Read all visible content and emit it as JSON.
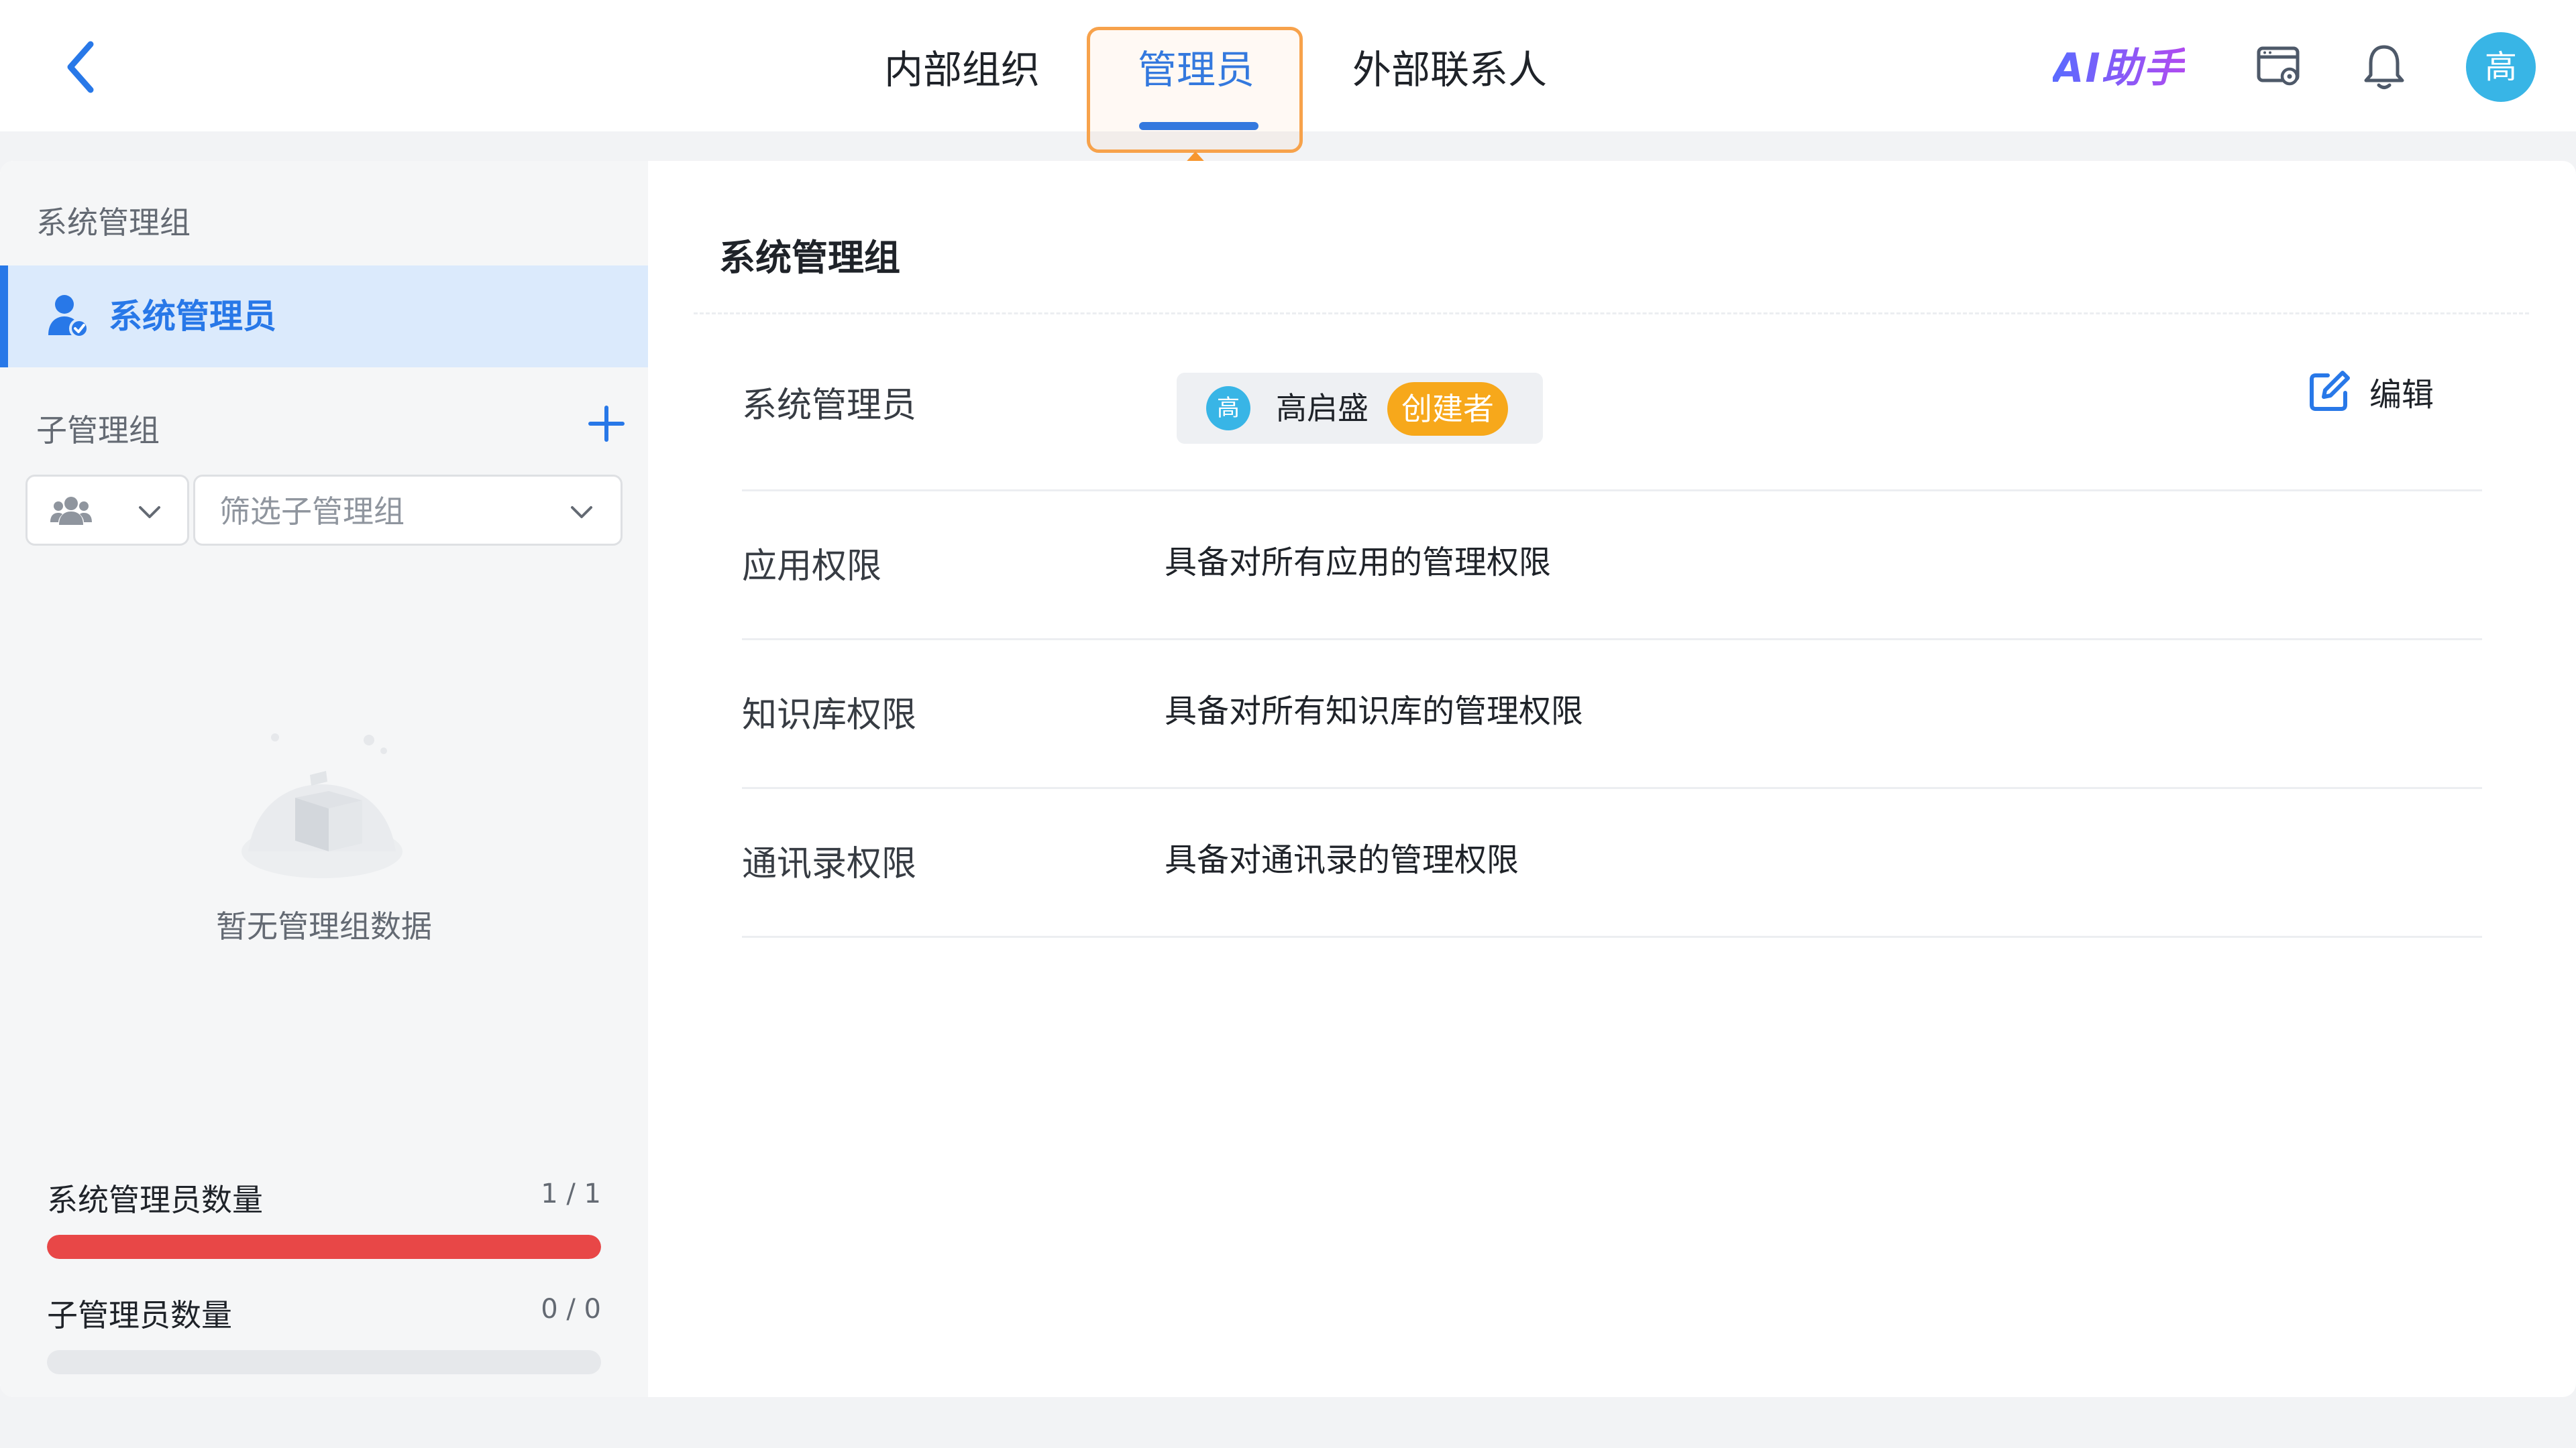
{
  "header": {
    "tabs": [
      {
        "label": "内部组织"
      },
      {
        "label": "管理员"
      },
      {
        "label": "外部联系人"
      }
    ],
    "active_tab": "管理员",
    "ai_label": "AI助手",
    "user_avatar": "高",
    "accent": "#2878e8",
    "highlight_color": "#f7a24b"
  },
  "sidebar": {
    "system_group_title": "系统管理组",
    "selected_item": "系统管理员",
    "sub_group_title": "子管理组",
    "filter_placeholder": "筛选子管理组",
    "empty_text": "暂无管理组数据",
    "stats": [
      {
        "label": "系统管理员数量",
        "value": "1 / 1",
        "fill": 1.0,
        "color": "#e84747"
      },
      {
        "label": "子管理员数量",
        "value": "0 / 0",
        "fill": 0.0,
        "color": "#e6e8eb"
      }
    ]
  },
  "main": {
    "title": "系统管理组",
    "edit_label": "编辑",
    "admin_row": {
      "label": "系统管理员",
      "avatar": "高",
      "name": "高启盛",
      "badge": "创建者"
    },
    "permissions": [
      {
        "label": "应用权限",
        "value": "具备对所有应用的管理权限"
      },
      {
        "label": "知识库权限",
        "value": "具备对所有知识库的管理权限"
      },
      {
        "label": "通讯录权限",
        "value": "具备对通讯录的管理权限"
      }
    ]
  }
}
